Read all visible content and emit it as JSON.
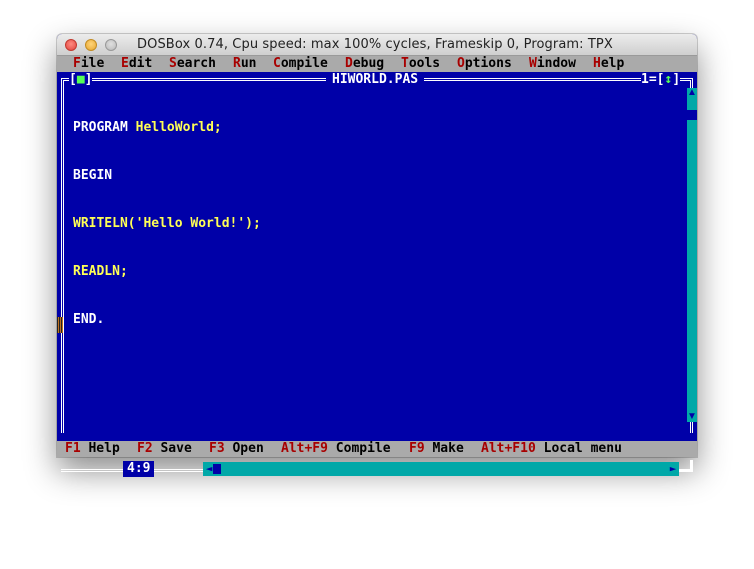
{
  "window": {
    "title": "DOSBox 0.74, Cpu speed: max 100% cycles, Frameskip  0, Program:     TPX"
  },
  "menu": {
    "items": [
      {
        "hot": "F",
        "rest": "ile"
      },
      {
        "hot": "E",
        "rest": "dit"
      },
      {
        "hot": "S",
        "rest": "earch"
      },
      {
        "hot": "R",
        "rest": "un"
      },
      {
        "hot": "C",
        "rest": "ompile"
      },
      {
        "hot": "D",
        "rest": "ebug"
      },
      {
        "hot": "T",
        "rest": "ools"
      },
      {
        "hot": "O",
        "rest": "ptions"
      },
      {
        "hot": "W",
        "rest": "indow"
      },
      {
        "hot": "H",
        "rest": "elp"
      }
    ]
  },
  "editor": {
    "close_box": {
      "left": "[",
      "inner": "■",
      "right": "]"
    },
    "file_name": "HIWORLD.PAS",
    "window_number": "1",
    "zoom_box": {
      "left": "[",
      "inner": "↕",
      "right": "]"
    },
    "code_lines": [
      {
        "kw": "PROGRAM",
        "rest": " HelloWorld;"
      },
      {
        "kw": "BEGIN",
        "rest": ""
      },
      {
        "kw": "",
        "rest": "WRITELN('Hello World!');"
      },
      {
        "kw": "",
        "rest": "READLN;"
      },
      {
        "kw": "END.",
        "rest": ""
      }
    ],
    "cursor_position": "4:9",
    "scroll_up_icon": "▲",
    "scroll_down_icon": "▼",
    "scroll_left_icon": "◄",
    "scroll_right_icon": "►"
  },
  "status": {
    "items": [
      {
        "key": "F1",
        "label": " Help"
      },
      {
        "key": "F2",
        "label": " Save"
      },
      {
        "key": "F3",
        "label": " Open"
      },
      {
        "key": "Alt+F9",
        "label": " Compile"
      },
      {
        "key": "F9",
        "label": " Make"
      },
      {
        "key": "Alt+F10",
        "label": " Local menu"
      }
    ]
  },
  "colors": {
    "background": "#0000a8",
    "menu_bar": "#aaaaaa",
    "hotkey": "#a80000",
    "code_text": "#ffff55",
    "scrollbar": "#00a8a8"
  }
}
